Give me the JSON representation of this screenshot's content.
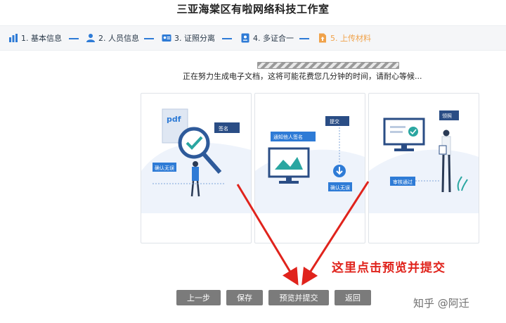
{
  "header": {
    "title": "三亚海棠区有啦网络科技工作室"
  },
  "steps": [
    {
      "label": "1. 基本信息",
      "icon": "bar-chart-icon"
    },
    {
      "label": "2. 人员信息",
      "icon": "person-icon"
    },
    {
      "label": "3. 证照分离",
      "icon": "id-card-icon"
    },
    {
      "label": "4. 多证合一",
      "icon": "certificate-icon"
    },
    {
      "label": "5. 上传材料",
      "icon": "upload-file-icon",
      "active": true
    }
  ],
  "progress": {
    "state": "indeterminate"
  },
  "status_message": "正在努力生成电子文档，这将可能花费您几分钟的时间，请耐心等候...",
  "cards": [
    {
      "doc_label": "pdf",
      "tag_sign": "签名",
      "tag_confirm": "确认无误"
    },
    {
      "tag_submit": "提交",
      "tag_notify": "通知他人签名",
      "tag_confirm": "确认无误"
    },
    {
      "tag_license": "领照",
      "tag_approved": "审核通过"
    }
  ],
  "buttons": {
    "prev": "上一步",
    "save": "保存",
    "preview_submit": "预览并提交",
    "back": "返回"
  },
  "annotation": "这里点击预览并提交",
  "watermark": "知乎 @阿迁",
  "colors": {
    "accent": "#2e7bd6",
    "active_step": "#f0a24a",
    "annotation": "#e0231c",
    "button": "#7b7b7b"
  }
}
